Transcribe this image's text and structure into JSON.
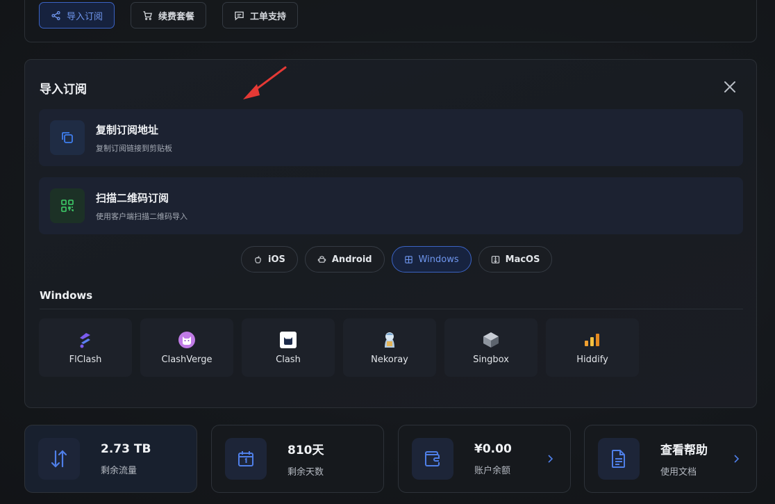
{
  "top_tabs": [
    {
      "label": "导入订阅",
      "icon": "share-icon",
      "active": true
    },
    {
      "label": "续费套餐",
      "icon": "cart-icon",
      "active": false
    },
    {
      "label": "工单支持",
      "icon": "message-icon",
      "active": false
    }
  ],
  "panel": {
    "title": "导入订阅",
    "options": [
      {
        "title": "复制订阅地址",
        "subtitle": "复制订阅链接到剪贴板",
        "icon": "copy-icon",
        "color": "#3f7ef0"
      },
      {
        "title": "扫描二维码订阅",
        "subtitle": "使用客户端扫描二维码导入",
        "icon": "qr-code-icon",
        "color": "#3fcf6a"
      }
    ],
    "platform_tabs": [
      {
        "label": "iOS",
        "icon": "apple-icon",
        "active": false
      },
      {
        "label": "Android",
        "icon": "android-icon",
        "active": false
      },
      {
        "label": "Windows",
        "icon": "windows-icon",
        "active": true
      },
      {
        "label": "MacOS",
        "icon": "macos-icon",
        "active": false
      }
    ],
    "section_title": "Windows",
    "apps": [
      {
        "name": "FlClash",
        "icon": "flclash-icon"
      },
      {
        "name": "ClashVerge",
        "icon": "clashverge-icon"
      },
      {
        "name": "Clash",
        "icon": "clash-icon"
      },
      {
        "name": "Nekoray",
        "icon": "nekoray-icon"
      },
      {
        "name": "Singbox",
        "icon": "singbox-icon"
      },
      {
        "name": "Hiddify",
        "icon": "hiddify-icon"
      }
    ]
  },
  "stats": [
    {
      "value": "2.73 TB",
      "label": "剩余流量",
      "icon": "traffic-arrows-icon"
    },
    {
      "value": "810天",
      "label": "剩余天数",
      "icon": "calendar-icon"
    },
    {
      "value": "¥0.00",
      "label": "账户余额",
      "icon": "wallet-icon"
    },
    {
      "value": "查看帮助",
      "label": "使用文档",
      "icon": "document-icon"
    }
  ],
  "colors": {
    "accent": "#3b63c4",
    "accent_text": "#6f96ee",
    "icon_blue": "#3f7ef0"
  }
}
